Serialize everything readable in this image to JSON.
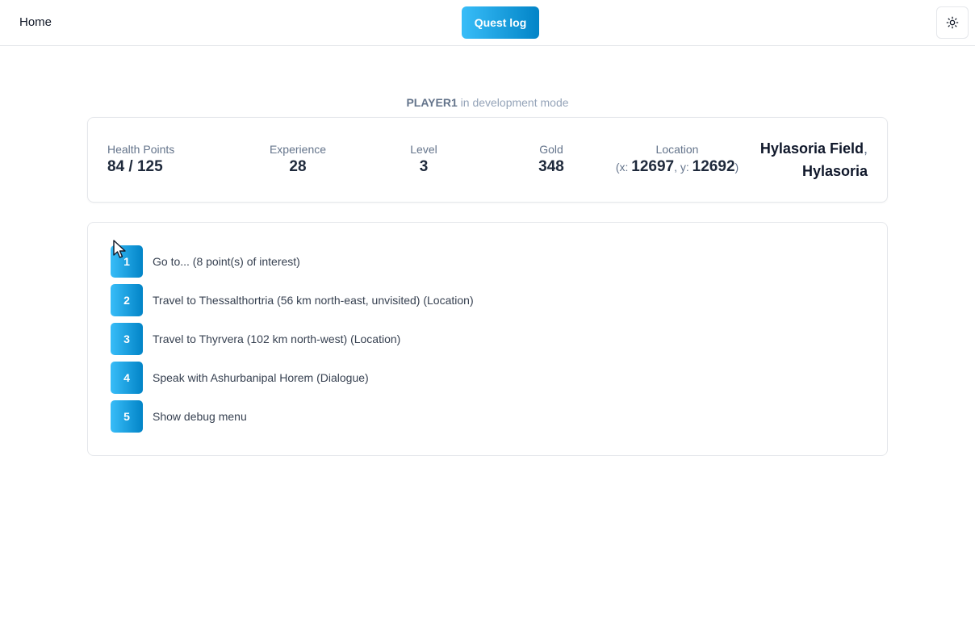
{
  "nav": {
    "home_label": "Home",
    "quest_log_label": "Quest log",
    "theme_toggle_icon": "sun-icon"
  },
  "status": {
    "player_name": "PLAYER1",
    "mode_text": "in development mode"
  },
  "stats": {
    "health_label": "Health Points",
    "health_value": "84 / 125",
    "experience_label": "Experience",
    "experience_value": "28",
    "level_label": "Level",
    "level_value": "3",
    "gold_label": "Gold",
    "gold_value": "348",
    "location_label": "Location",
    "x_prefix": "(x: ",
    "x_value": "12697",
    "y_prefix": ", y: ",
    "y_value": "12692",
    "coord_suffix": ")",
    "place_name": "Hylasoria Field",
    "place_separator": ",",
    "region_name": "Hylasoria"
  },
  "actions": [
    {
      "number": "1",
      "label": "Go to... (8 point(s) of interest)"
    },
    {
      "number": "2",
      "label": "Travel to Thessalthortria (56 km north-east, unvisited) (Location)"
    },
    {
      "number": "3",
      "label": "Travel to Thyrvera (102 km north-west) (Location)"
    },
    {
      "number": "4",
      "label": "Speak with Ashurbanipal Horem (Dialogue)"
    },
    {
      "number": "5",
      "label": "Show debug menu"
    }
  ],
  "colors": {
    "accent_start": "#38bdf8",
    "accent_end": "#0284c7"
  }
}
